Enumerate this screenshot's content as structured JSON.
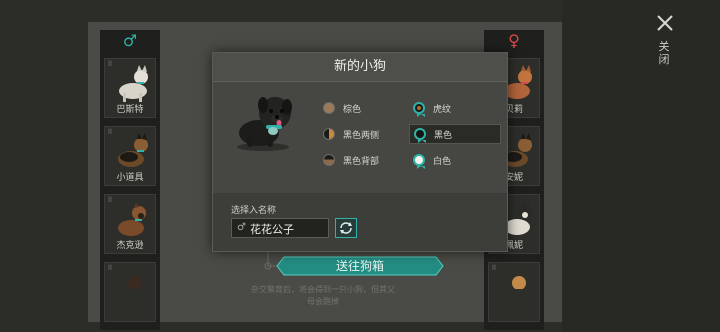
{
  "left_column": {
    "gender_symbol": "♂",
    "dogs": [
      {
        "name": "巴斯特"
      },
      {
        "name": "小道具"
      },
      {
        "name": "杰克逊"
      },
      {
        "name": ""
      }
    ]
  },
  "right_column": {
    "gender_symbol": "♀",
    "dogs": [
      {
        "name": "贝莉"
      },
      {
        "name": "安妮"
      },
      {
        "name": "佩妮"
      },
      {
        "name": ""
      }
    ]
  },
  "close": {
    "label": "关闭"
  },
  "dialog": {
    "title": "新的小狗",
    "coat_options": [
      {
        "label": "棕色",
        "color": "#9b7a5a",
        "selected": false
      },
      {
        "label": "黑色两侧",
        "color": "#c98a3a",
        "selected": false
      },
      {
        "label": "黑色背部",
        "color": "#8a6a4a",
        "selected": false
      },
      {
        "label": "虎纹",
        "color": "#b06a2a",
        "selected": true
      },
      {
        "label": "黑色",
        "color": "#151512",
        "selected": true,
        "highlighted": true
      },
      {
        "label": "白色",
        "color": "#f4f4f0",
        "selected": true
      }
    ],
    "name_section": {
      "label": "选择入名称",
      "gender_symbol": "♂",
      "value": "花花公子"
    }
  },
  "send_button": {
    "label": "送往狗箱"
  },
  "hint": {
    "text": "杂交繁育后，将会得到一只小狗，但其父母会跑掉"
  },
  "colors": {
    "accent": "#2fb3a8",
    "male": "#2fb3a8",
    "female": "#d64b4b"
  }
}
